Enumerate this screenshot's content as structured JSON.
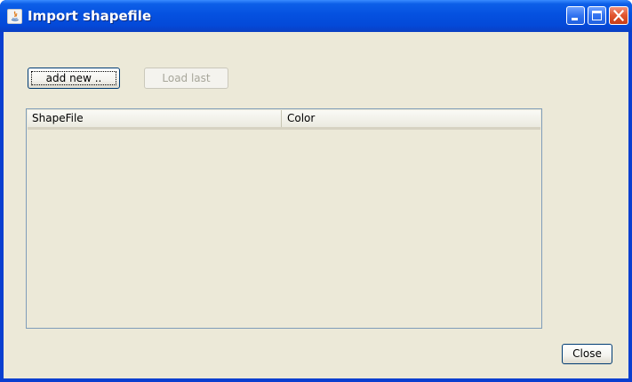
{
  "window": {
    "title": "Import shapefile"
  },
  "icons": {
    "app": "java-app-icon",
    "minimize": "minimize-icon",
    "maximize": "maximize-icon",
    "close": "close-icon"
  },
  "toolbar": {
    "add_new_label": "add new ..",
    "load_last_label": "Load last",
    "load_last_enabled": false
  },
  "table": {
    "columns": [
      "ShapeFile",
      "Color"
    ],
    "rows": []
  },
  "footer": {
    "close_label": "Close"
  },
  "colors": {
    "titlebar": "#0551e0",
    "client_background": "#ece9d8",
    "close_button": "#e1542d",
    "disabled_text": "#a7a69a",
    "table_border": "#7f9db9"
  }
}
